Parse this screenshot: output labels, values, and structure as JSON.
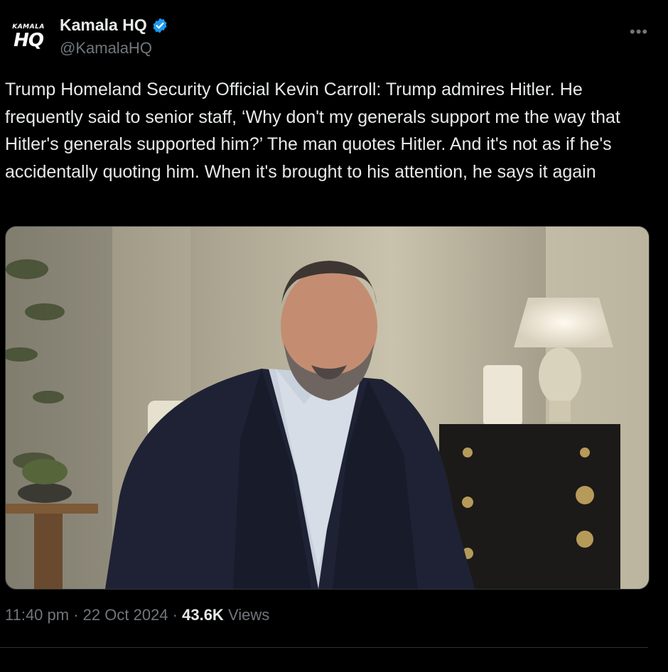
{
  "author": {
    "avatar_top": "KAMALA",
    "avatar_bottom": "HQ",
    "display_name": "Kamala HQ",
    "handle": "@KamalaHQ"
  },
  "more_icon": "•••",
  "tweet_text": "Trump Homeland Security Official Kevin Carroll: Trump admires Hitler. He frequently said to senior staff, ‘Why don't my generals support me the way that Hitler's generals supported him?’ The man quotes Hitler. And it's not as if he's accidentally quoting him. When it's brought to his attention, he says it again",
  "meta": {
    "time": "11:40 pm",
    "sep1": " · ",
    "date": "22 Oct 2024",
    "sep2": " · ",
    "views_count": "43.6K",
    "views_label": " Views"
  },
  "colors": {
    "background": "#000000",
    "text": "#e7e9ea",
    "secondary": "#71767b",
    "verified": "#1d9bf0"
  },
  "icons": [
    "verified-badge-icon",
    "more-options-icon"
  ]
}
